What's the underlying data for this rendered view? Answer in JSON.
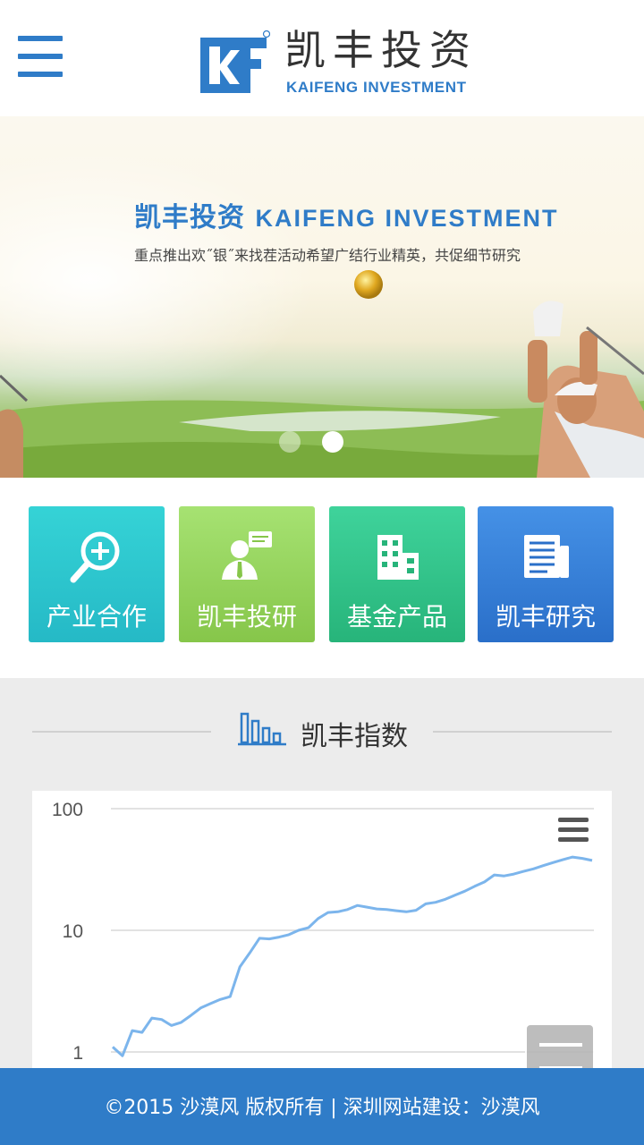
{
  "header": {
    "logo_cn": "凯丰投资",
    "logo_en": "KAIFENG INVESTMENT",
    "logo_mark_text": "KF",
    "menu_icon": "hamburger-menu-icon"
  },
  "banner": {
    "title_cn": "凯丰投资",
    "title_en": "KAIFENG INVESTMENT",
    "subtitle": "重点推出欢˝银˝来找茬活动希望广结行业精英，共促细节研究",
    "slide_count": 2,
    "active_slide": 2
  },
  "quick_nav": [
    {
      "label": "产业合作",
      "icon": "magnifier-plus-icon",
      "color_top": "#35d3d6",
      "color_bottom": "#25b9c6"
    },
    {
      "label": "凯丰投研",
      "icon": "person-chat-icon",
      "color_top": "#a6e272",
      "color_bottom": "#86c64a"
    },
    {
      "label": "基金产品",
      "icon": "building-icon",
      "color_top": "#3fd39b",
      "color_bottom": "#27b47a"
    },
    {
      "label": "凯丰研究",
      "icon": "newspaper-icon",
      "color_top": "#4591e6",
      "color_bottom": "#2a6fc9"
    }
  ],
  "index_section": {
    "title": "凯丰指数",
    "icon": "bar-chart-icon"
  },
  "chart_data": {
    "type": "line",
    "title": "",
    "xlabel": "",
    "ylabel": "",
    "y_scale": "log",
    "ylim": [
      1,
      100
    ],
    "yticks": [
      "100",
      "10",
      "1"
    ],
    "grid": true,
    "legend": "none",
    "line_color": "#7cb5ec",
    "series": [
      {
        "values": [
          1.1,
          0.93,
          1.5,
          1.45,
          1.9,
          1.85,
          1.65,
          1.75,
          2.0,
          2.3,
          2.5,
          2.7,
          2.85,
          5.0,
          6.5,
          8.6,
          8.5,
          8.8,
          9.2,
          10.0,
          10.5,
          12.5,
          14.0,
          14.2,
          14.8,
          16.0,
          15.5,
          15.0,
          14.8,
          14.5,
          14.2,
          14.6,
          16.5,
          17.0,
          18.0,
          19.5,
          21.0,
          23.0,
          25.0,
          28.5,
          28.0,
          29.0,
          30.5,
          32.0,
          34.0,
          36.0,
          38.0,
          40.0,
          39.0,
          37.5
        ]
      }
    ]
  },
  "footer": {
    "text": "©2015 沙漠风 版权所有 | 深圳网站建设：沙漠风"
  }
}
